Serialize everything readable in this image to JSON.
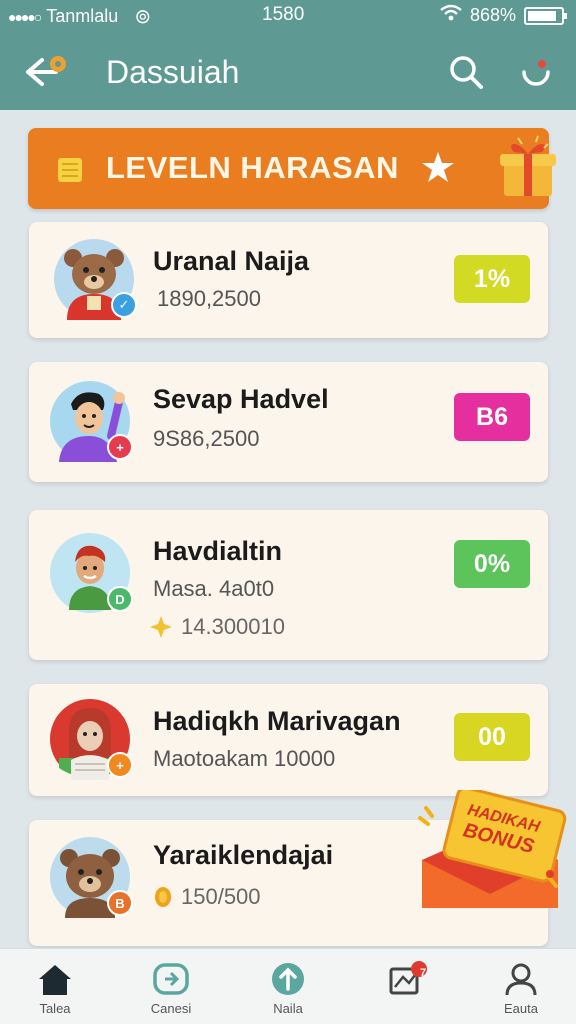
{
  "status": {
    "carrier": "Tanmlalu",
    "time": "1580",
    "battery": "868%"
  },
  "header": {
    "title": "Dassuiah"
  },
  "banner": {
    "title": "LEVELN HARASAN"
  },
  "cards": [
    {
      "name": "Uranal Naija",
      "line1": "1890,2500",
      "pill": "1%",
      "pill_color": "#d2da24",
      "badge_color": "#3aa0e0",
      "badge_text": "✓"
    },
    {
      "name": "Sevap Hadvel",
      "line1": "9S86,2500",
      "pill": "B6",
      "pill_color": "#e62f9e",
      "badge_color": "#e63a4f",
      "badge_text": "+"
    },
    {
      "name": "Havdialtin",
      "line1": "Masa. 4a0t0",
      "line2": "14.300010",
      "pill": "0%",
      "pill_color": "#5cc45b",
      "badge_color": "#4cb86a",
      "badge_text": "D"
    },
    {
      "name": "Hadiqkh Marivagan",
      "line1": "Maotoakam 10000",
      "pill": "00",
      "pill_color": "#d8d623",
      "badge_color": "#f08a1e",
      "badge_text": "+"
    },
    {
      "name": "Yaraiklendajai",
      "line1": "150/500",
      "badge_color": "#e8722a",
      "badge_text": "B"
    }
  ],
  "bonus": {
    "line1": "HADIKAH",
    "line2": "BONUS"
  },
  "nav": [
    {
      "label": "Talea"
    },
    {
      "label": "Canesi"
    },
    {
      "label": "Naila"
    },
    {
      "label": "",
      "badge": "7"
    },
    {
      "label": "Eauta"
    }
  ]
}
